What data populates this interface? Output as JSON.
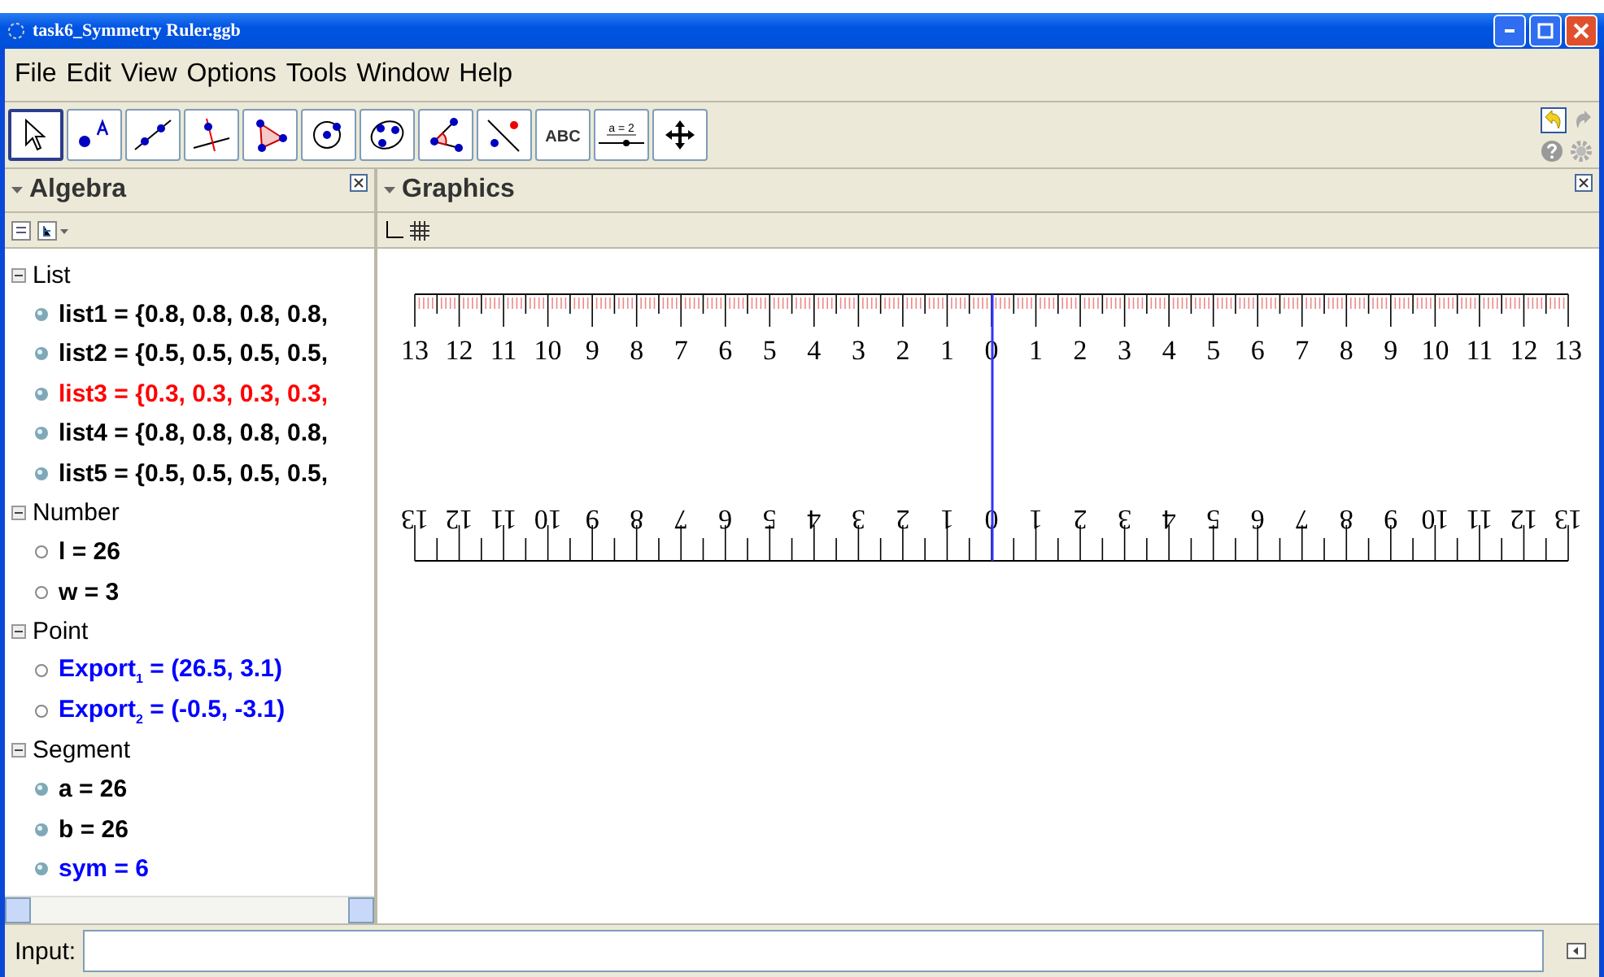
{
  "window": {
    "title": "task6_Symmetry Ruler.ggb"
  },
  "menu": [
    "File",
    "Edit",
    "View",
    "Options",
    "Tools",
    "Window",
    "Help"
  ],
  "toolbar": [
    {
      "kind": "pointer",
      "selected": true
    },
    {
      "kind": "point",
      "selected": false
    },
    {
      "kind": "line",
      "selected": false
    },
    {
      "kind": "perpendicular",
      "selected": false
    },
    {
      "kind": "polygon",
      "selected": false
    },
    {
      "kind": "circle",
      "selected": false
    },
    {
      "kind": "ellipse",
      "selected": false
    },
    {
      "kind": "angle",
      "selected": false
    },
    {
      "kind": "reflect",
      "selected": false
    },
    {
      "kind": "text",
      "label": "ABC",
      "selected": false
    },
    {
      "kind": "slider",
      "label": "a = 2",
      "selected": false
    },
    {
      "kind": "move",
      "selected": false
    }
  ],
  "algebra": {
    "title": "Algebra",
    "groups": [
      {
        "name": "List",
        "expanded": true,
        "children": [
          {
            "text": "list1 = {0.8, 0.8, 0.8, 0.8,",
            "color": "#000000",
            "kind": "ball"
          },
          {
            "text": "list2 = {0.5, 0.5, 0.5, 0.5,",
            "color": "#000000",
            "kind": "ball"
          },
          {
            "text": "list3 = {0.3, 0.3, 0.3, 0.3,",
            "color": "#ff0000",
            "kind": "ball"
          },
          {
            "text": "list4 = {0.8, 0.8, 0.8, 0.8,",
            "color": "#000000",
            "kind": "ball"
          },
          {
            "text": "list5 = {0.5, 0.5, 0.5, 0.5,",
            "color": "#000000",
            "kind": "ball"
          }
        ]
      },
      {
        "name": "Number",
        "expanded": true,
        "children": [
          {
            "text": "l = 26",
            "color": "#000000",
            "kind": "ring"
          },
          {
            "text": "w = 3",
            "color": "#000000",
            "kind": "ring"
          }
        ]
      },
      {
        "name": "Point",
        "expanded": true,
        "children": [
          {
            "text": "Export$_{1}$ = (26.5, 3.1)",
            "color": "#0000ff",
            "kind": "ring"
          },
          {
            "text": "Export$_{2}$ = (-0.5, -3.1)",
            "color": "#0000ff",
            "kind": "ring"
          }
        ]
      },
      {
        "name": "Segment",
        "expanded": true,
        "children": [
          {
            "text": "a = 26",
            "color": "#000000",
            "kind": "ball"
          },
          {
            "text": "b = 26",
            "color": "#000000",
            "kind": "ball"
          },
          {
            "text": "sym = 6",
            "color": "#0000ff",
            "kind": "ball"
          }
        ]
      }
    ]
  },
  "graphics": {
    "title": "Graphics",
    "top_labels": [
      "13",
      "12",
      "11",
      "10",
      "9",
      "8",
      "7",
      "6",
      "5",
      "4",
      "3",
      "2",
      "1",
      "0",
      "1",
      "2",
      "3",
      "4",
      "5",
      "6",
      "7",
      "8",
      "9",
      "10",
      "11",
      "12",
      "13"
    ],
    "bottom_labels": [
      "13",
      "12",
      "11",
      "10",
      "9",
      "8",
      "7",
      "6",
      "5",
      "4",
      "3",
      "2",
      "1",
      "0",
      "1",
      "2",
      "3",
      "4",
      "5",
      "6",
      "7",
      "8",
      "9",
      "10",
      "11",
      "12",
      "13"
    ]
  },
  "input": {
    "label": "Input:"
  }
}
